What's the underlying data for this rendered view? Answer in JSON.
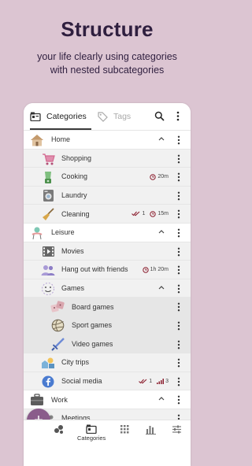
{
  "promo": {
    "title": "Structure",
    "subtitle": "your life clearly using categories with nested subcategories"
  },
  "topbar": {
    "tab_categories": "Categories",
    "tab_tags": "Tags",
    "search_icon": "search-icon",
    "more_icon": "more-vert-icon"
  },
  "colors": {
    "background": "#dcc5d2",
    "accent": "#8a5c8b",
    "title": "#2f1f3f",
    "clock": "#8b1e2e"
  },
  "rows": [
    {
      "label": "Home",
      "level": 0,
      "icon": "house-icon",
      "chevron": true,
      "time": "",
      "count": "",
      "bars": ""
    },
    {
      "label": "Shopping",
      "level": 1,
      "icon": "cart-icon",
      "chevron": false,
      "time": "",
      "count": "",
      "bars": ""
    },
    {
      "label": "Cooking",
      "level": 1,
      "icon": "blender-icon",
      "chevron": false,
      "time": "20m",
      "count": "",
      "bars": ""
    },
    {
      "label": "Laundry",
      "level": 1,
      "icon": "washing-machine-icon",
      "chevron": false,
      "time": "",
      "count": "",
      "bars": ""
    },
    {
      "label": "Cleaning",
      "level": 1,
      "icon": "broom-icon",
      "chevron": false,
      "time": "15m",
      "count": "1",
      "bars": ""
    },
    {
      "label": "Leisure",
      "level": 0,
      "icon": "lounger-icon",
      "chevron": true,
      "time": "",
      "count": "",
      "bars": ""
    },
    {
      "label": "Movies",
      "level": 1,
      "icon": "film-icon",
      "chevron": false,
      "time": "",
      "count": "",
      "bars": ""
    },
    {
      "label": "Hang out with friends",
      "level": 1,
      "icon": "people-icon",
      "chevron": false,
      "time": "1h 20m",
      "count": "",
      "bars": ""
    },
    {
      "label": "Games",
      "level": 1,
      "icon": "smiley-icon",
      "chevron": true,
      "time": "",
      "count": "",
      "bars": ""
    },
    {
      "label": "Board games",
      "level": 2,
      "icon": "dice-icon",
      "chevron": false,
      "time": "",
      "count": "",
      "bars": ""
    },
    {
      "label": "Sport games",
      "level": 2,
      "icon": "volleyball-icon",
      "chevron": false,
      "time": "",
      "count": "",
      "bars": ""
    },
    {
      "label": "Video games",
      "level": 2,
      "icon": "sword-icon",
      "chevron": false,
      "time": "",
      "count": "",
      "bars": ""
    },
    {
      "label": "City trips",
      "level": 1,
      "icon": "city-icon",
      "chevron": false,
      "time": "",
      "count": "",
      "bars": ""
    },
    {
      "label": "Social media",
      "level": 1,
      "icon": "facebook-icon",
      "chevron": false,
      "time": "",
      "count": "1",
      "bars": "3"
    },
    {
      "label": "Work",
      "level": 0,
      "icon": "briefcase-icon",
      "chevron": true,
      "time": "",
      "count": "",
      "bars": ""
    },
    {
      "label": "Meetings",
      "level": 1,
      "icon": "meeting-icon",
      "chevron": false,
      "time": "",
      "count": "",
      "bars": ""
    }
  ],
  "bottomnav": {
    "fab_label": "+",
    "categories_label": "Categories",
    "icons": [
      "bubbles-icon",
      "categories-icon",
      "grid-icon",
      "bar-chart-icon",
      "sliders-icon"
    ]
  }
}
